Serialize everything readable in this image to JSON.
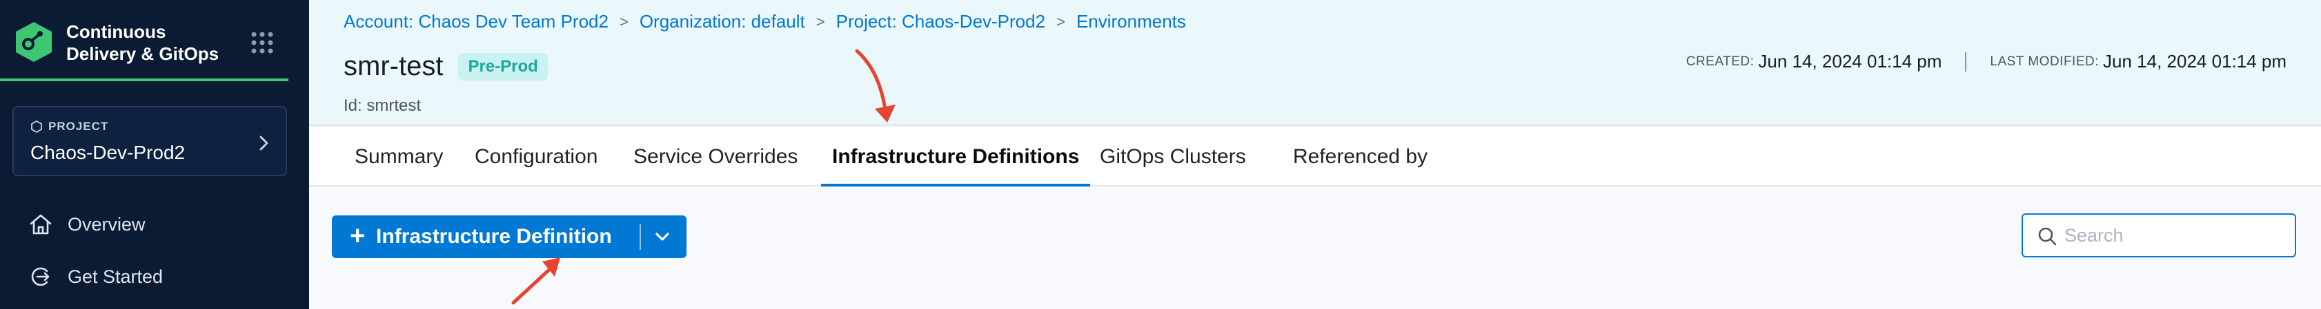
{
  "sidebar": {
    "module_title_line1": "Continuous",
    "module_title_line2": "Delivery & GitOps",
    "project_label": "PROJECT",
    "project_name": "Chaos-Dev-Prod2",
    "nav": [
      {
        "label": "Overview",
        "icon": "home-icon"
      },
      {
        "label": "Get Started",
        "icon": "get-started-icon"
      }
    ]
  },
  "breadcrumb": [
    "Account: Chaos Dev Team Prod2",
    "Organization: default",
    "Project: Chaos-Dev-Prod2",
    "Environments"
  ],
  "header": {
    "title": "smr-test",
    "badge": "Pre-Prod",
    "id_text": "Id: smrtest",
    "created_label": "CREATED:",
    "created_value": "Jun 14, 2024 01:14 pm",
    "modified_label": "LAST MODIFIED:",
    "modified_value": "Jun 14, 2024 01:14 pm"
  },
  "tabs": [
    {
      "label": "Summary",
      "active": false
    },
    {
      "label": "Configuration",
      "active": false
    },
    {
      "label": "Service Overrides",
      "active": false
    },
    {
      "label": "Infrastructure Definitions",
      "active": true
    },
    {
      "label": "GitOps Clusters",
      "active": false
    },
    {
      "label": "Referenced by",
      "active": false
    }
  ],
  "content": {
    "add_button_label": "Infrastructure Definition",
    "search_placeholder": "Search"
  },
  "colors": {
    "accent": "#0278d5",
    "sidebar_bg": "#0b1b33",
    "header_bg": "#eaf7fb",
    "badge_bg": "#c9f2f0",
    "badge_text": "#1aa9a0",
    "annotation_arrow": "#e8432e"
  }
}
